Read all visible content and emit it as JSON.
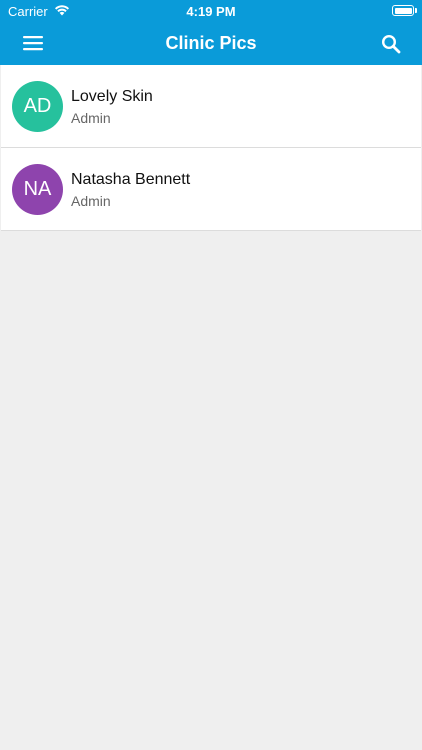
{
  "status_bar": {
    "carrier": "Carrier",
    "time": "4:19 PM",
    "icons": [
      "wifi-icon",
      "battery-icon"
    ]
  },
  "app_bar": {
    "title": "Clinic Pics",
    "left_icon": "menu-icon",
    "right_icon": "search-icon",
    "color": "#0a9bd9"
  },
  "list": {
    "items": [
      {
        "initials": "AD",
        "name": "Lovely Skin",
        "role": "Admin",
        "avatar_color": "#26c19d"
      },
      {
        "initials": "NA",
        "name": "Natasha Bennett",
        "role": "Admin",
        "avatar_color": "#8e44ad"
      }
    ]
  }
}
